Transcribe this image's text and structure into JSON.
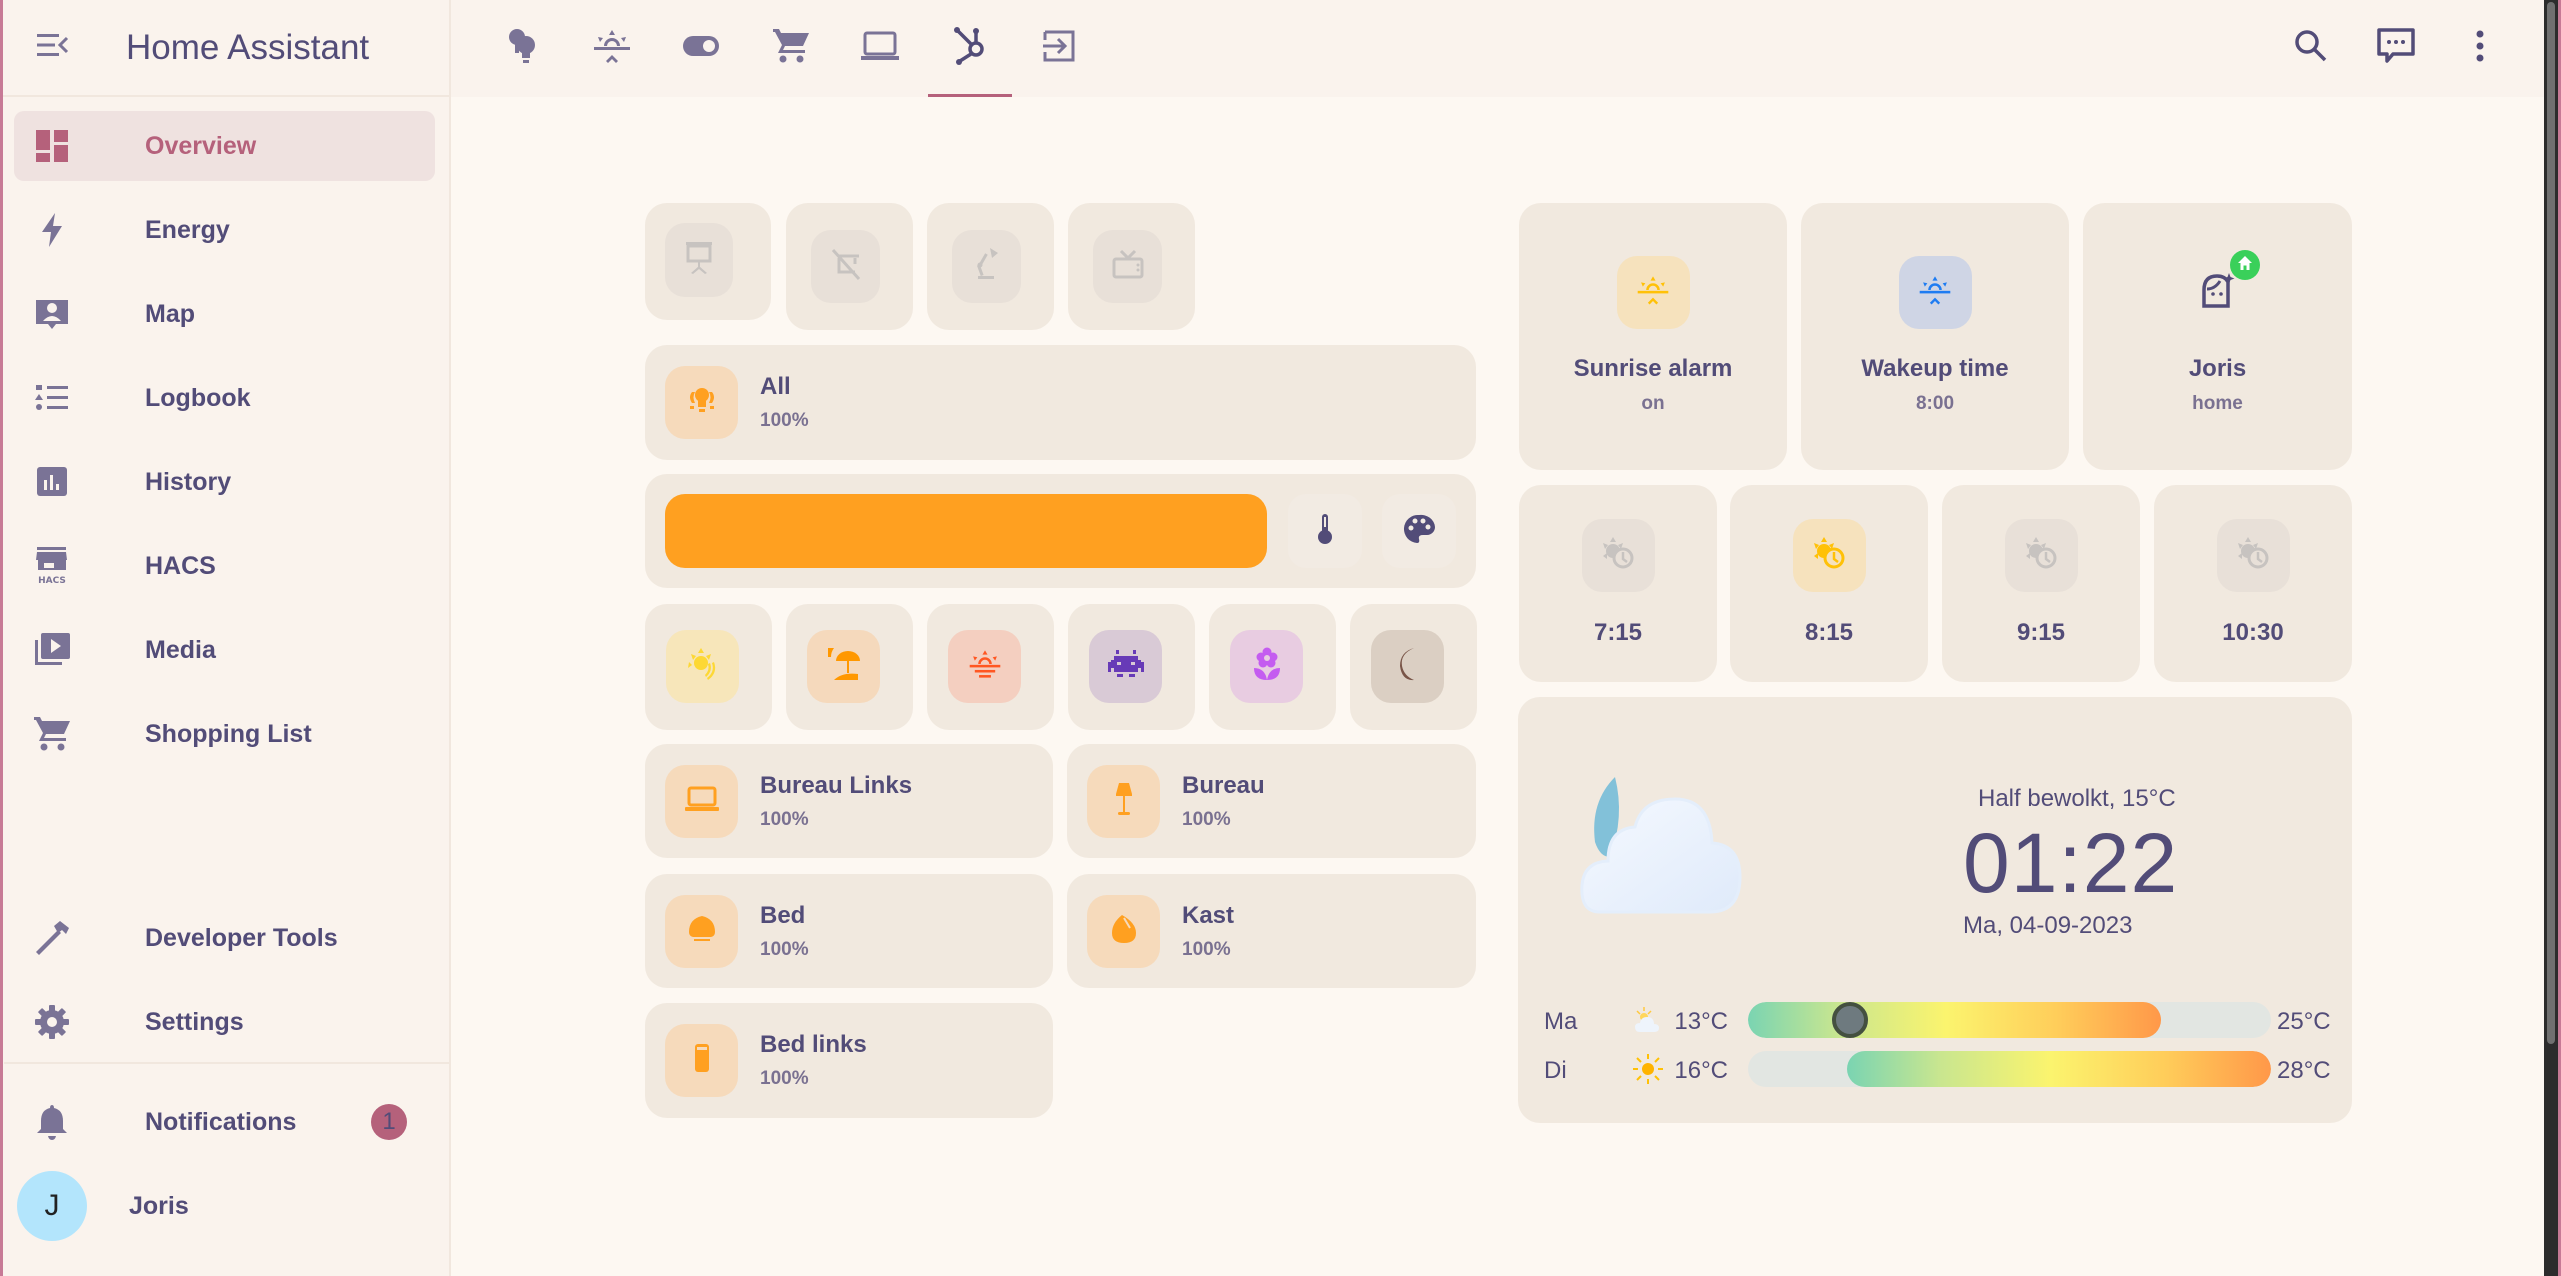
{
  "app": {
    "title": "Home Assistant"
  },
  "sidebar": {
    "items": [
      {
        "label": "Overview",
        "icon": "view-dashboard-icon",
        "active": true
      },
      {
        "label": "Energy",
        "icon": "lightning-bolt-icon"
      },
      {
        "label": "Map",
        "icon": "account-box-icon"
      },
      {
        "label": "Logbook",
        "icon": "format-list-bulleted-type-icon"
      },
      {
        "label": "History",
        "icon": "chart-box-icon"
      },
      {
        "label": "HACS",
        "icon": "hacs-store-icon"
      },
      {
        "label": "Media",
        "icon": "play-box-multiple-icon"
      },
      {
        "label": "Shopping List",
        "icon": "cart-icon"
      }
    ],
    "bottom_items": [
      {
        "label": "Developer Tools",
        "icon": "hammer-icon"
      },
      {
        "label": "Settings",
        "icon": "cog-icon"
      }
    ],
    "notifications": {
      "label": "Notifications",
      "count": "1"
    },
    "user": {
      "name": "Joris",
      "initial": "J"
    }
  },
  "toolbar": {
    "tabs": [
      {
        "icon": "lightbulb-group-icon"
      },
      {
        "icon": "weather-sunset-icon"
      },
      {
        "icon": "toggle-switch-icon"
      },
      {
        "icon": "cart-icon"
      },
      {
        "icon": "laptop-icon"
      },
      {
        "icon": "hubspot-icon",
        "active": true
      },
      {
        "icon": "login-icon"
      }
    ],
    "actions": [
      {
        "icon": "search-icon"
      },
      {
        "icon": "assist-chat-icon"
      },
      {
        "icon": "dots-vertical-icon"
      }
    ]
  },
  "lights": {
    "quick_buttons": [
      {
        "icon": "projector-screen-icon",
        "state": "off"
      },
      {
        "icon": "projector-screen-off-icon",
        "state": "off"
      },
      {
        "icon": "desk-lamp-icon",
        "state": "off"
      },
      {
        "icon": "television-icon",
        "state": "off"
      }
    ],
    "all": {
      "name": "All",
      "state": "100%"
    },
    "brightness": {
      "value_percent": 100,
      "color": "#ffa020"
    },
    "controls": [
      {
        "icon": "thermometer-icon"
      },
      {
        "icon": "palette-icon"
      }
    ],
    "scenes": [
      {
        "icon": "weather-sunny-icon",
        "color": "#fdd835",
        "bg": "#f7e6ba"
      },
      {
        "icon": "beach-icon",
        "color": "#ff9800",
        "bg": "#f5d9bc"
      },
      {
        "icon": "weather-sunset-icon",
        "color": "#ff5722",
        "bg": "#f4cfc0"
      },
      {
        "icon": "space-invaders-icon",
        "color": "#673ab7",
        "bg": "#d9cad6"
      },
      {
        "icon": "flower-icon",
        "color": "#c45cf0",
        "bg": "#e8cce1"
      },
      {
        "icon": "moon-icon",
        "color": "#795548",
        "bg": "#dbcfc3"
      }
    ],
    "tiles": [
      {
        "name": "Bureau Links",
        "state": "100%",
        "icon": "laptop-icon"
      },
      {
        "name": "Bureau",
        "state": "100%",
        "icon": "floor-lamp-icon"
      },
      {
        "name": "Bed",
        "state": "100%",
        "icon": "ceiling-light-icon"
      },
      {
        "name": "Kast",
        "state": "100%",
        "icon": "vase-lamp-icon"
      },
      {
        "name": "Bed links",
        "state": "100%",
        "icon": "cylinder-lamp-icon"
      }
    ]
  },
  "alarm": {
    "cards": [
      {
        "name": "Sunrise alarm",
        "state": "on",
        "icon": "weather-sunset-up-icon"
      },
      {
        "name": "Wakeup time",
        "state": "8:00",
        "icon": "weather-sunset-up-icon"
      },
      {
        "name": "Joris",
        "state": "home",
        "icon": "face-woman-shimmer-icon",
        "badge_icon": "home-icon"
      }
    ],
    "times": [
      {
        "label": "7:15",
        "active": false
      },
      {
        "label": "8:15",
        "active": true
      },
      {
        "label": "9:15",
        "active": false
      },
      {
        "label": "10:30",
        "active": false
      }
    ]
  },
  "weather": {
    "condition": "Half bewolkt, 15°C",
    "time": "01:22",
    "date": "Ma, 04-09-2023",
    "icon": "partly-cloudy-night-icon",
    "forecast": [
      {
        "day": "Ma",
        "icon": "partly-cloudy-icon",
        "low": "13°C",
        "high": "25°C",
        "fill_start": 0.0,
        "fill_end": 0.79,
        "current_marker": 0.16
      },
      {
        "day": "Di",
        "icon": "sunny-icon",
        "low": "16°C",
        "high": "28°C",
        "fill_start": 0.19,
        "fill_end": 1.0
      }
    ]
  }
}
